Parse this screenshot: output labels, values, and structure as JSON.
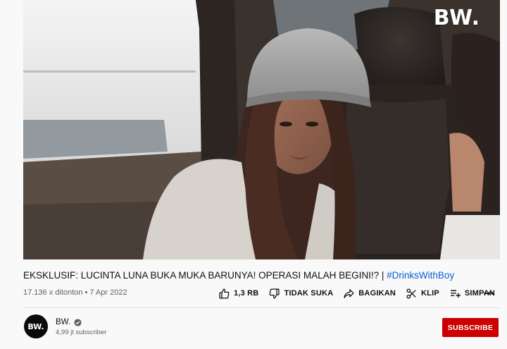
{
  "video": {
    "watermark": "BW.",
    "title_main": "EKSKLUSIF: LUCINTA LUNA BUKA MUKA BARUNYA! OPERASI MALAH BEGINI!? | ",
    "title_hashtag": "#DrinksWithBoy",
    "meta": "17.136 x ditonton • 7 Apr 2022"
  },
  "actions": {
    "like": {
      "label": "1,3 RB",
      "icon": "thumbs-up-icon"
    },
    "dislike": {
      "label": "TIDAK SUKA",
      "icon": "thumbs-down-icon"
    },
    "share": {
      "label": "BAGIKAN",
      "icon": "share-icon"
    },
    "clip": {
      "label": "KLIP",
      "icon": "scissors-icon"
    },
    "save": {
      "label": "SIMPAN",
      "icon": "playlist-add-icon"
    },
    "more": {
      "icon": "more-horizontal-icon"
    }
  },
  "channel": {
    "avatar_text": "BW.",
    "name": "BW.",
    "subscribers": "4,99 jt subscriber",
    "subscribe_label": "SUBSCRIBE"
  },
  "colors": {
    "subscribe": "#cc0000",
    "hashtag": "#065fd4",
    "background": "#f9f9f9"
  }
}
